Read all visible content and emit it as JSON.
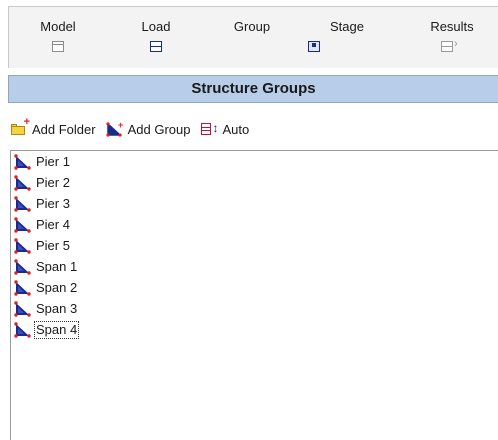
{
  "tabs": [
    {
      "label": "Model",
      "icon": "model-icon"
    },
    {
      "label": "Load",
      "icon": "load-icon"
    },
    {
      "label": "Group",
      "icon": "group-icon"
    },
    {
      "label": "Stage",
      "icon": "stage-icon"
    },
    {
      "label": "Results",
      "icon": "results-icon"
    }
  ],
  "panel": {
    "title": "Structure Groups"
  },
  "toolbar": {
    "add_folder": "Add Folder",
    "add_group": "Add Group",
    "auto": "Auto"
  },
  "tree": {
    "items": [
      {
        "label": "Pier 1"
      },
      {
        "label": "Pier 2"
      },
      {
        "label": "Pier 3"
      },
      {
        "label": "Pier 4"
      },
      {
        "label": "Pier 5"
      },
      {
        "label": "Span 1"
      },
      {
        "label": "Span 2"
      },
      {
        "label": "Span 3"
      },
      {
        "label": "Span 4"
      }
    ],
    "focused_index": 8
  },
  "colors": {
    "header_bg": "#b7cde8",
    "group_icon_blue": "#1b2a8f",
    "group_icon_red": "#e02020",
    "tabstrip_bg": "#f3f3f3"
  }
}
